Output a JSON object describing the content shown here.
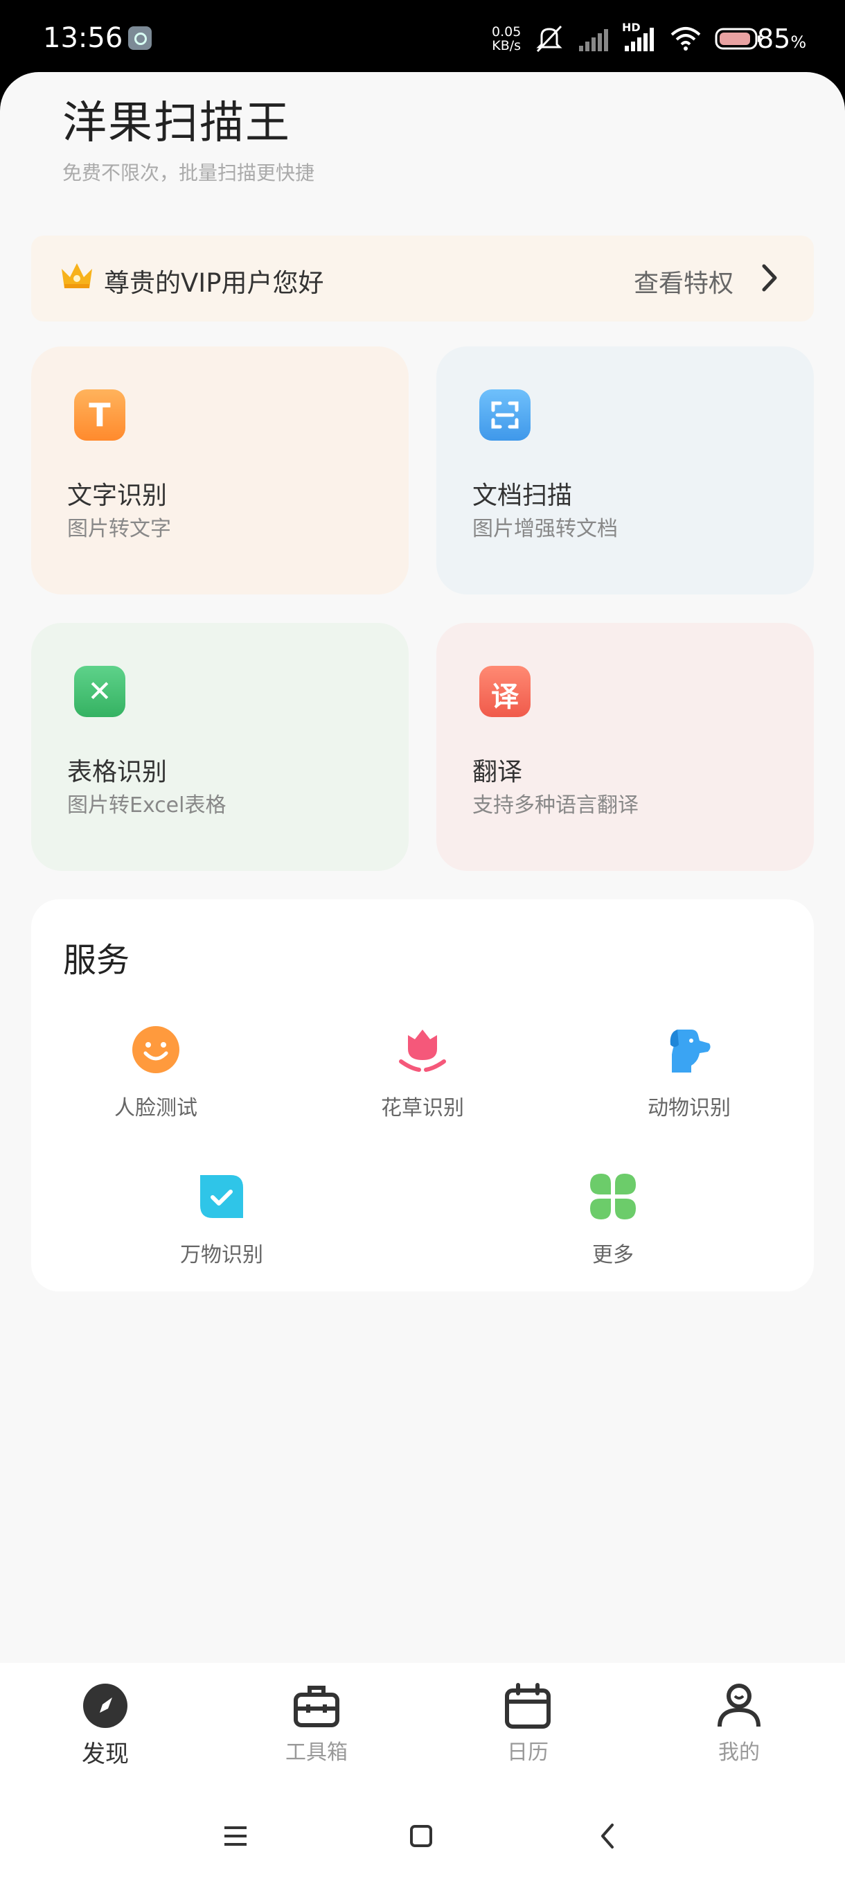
{
  "status_bar": {
    "time": "13:56",
    "net_speed_value": "0.05",
    "net_speed_unit": "KB/s",
    "hd_label": "HD",
    "battery_percent": "85",
    "battery_unit": "%"
  },
  "header": {
    "title": "洋果扫描王",
    "subtitle": "免费不限次，批量扫描更快捷"
  },
  "vip": {
    "greeting": "尊贵的VIP用户您好",
    "link_label": "查看特权"
  },
  "features": [
    {
      "title": "文字识别",
      "subtitle": "图片转文字",
      "icon": "text-recognition-icon",
      "icon_glyph": "T",
      "color": "#ff9a3d",
      "bg": "#fbf2ea"
    },
    {
      "title": "文档扫描",
      "subtitle": "图片增强转文档",
      "icon": "document-scan-icon",
      "color": "#4aa6f0",
      "bg": "#eef3f6"
    },
    {
      "title": "表格识别",
      "subtitle": "图片转Excel表格",
      "icon": "table-recognition-icon",
      "icon_glyph": "✕",
      "color": "#3dbb6a",
      "bg": "#eef5ee"
    },
    {
      "title": "翻译",
      "subtitle": "支持多种语言翻译",
      "icon": "translate-icon",
      "icon_glyph": "译",
      "color": "#f86a5a",
      "bg": "#f9eeed"
    }
  ],
  "services": {
    "title": "服务",
    "items": [
      {
        "label": "人脸测试",
        "icon": "smiley-face-icon",
        "color": "#ff9a3d"
      },
      {
        "label": "花草识别",
        "icon": "tulip-icon",
        "color": "#f5587a"
      },
      {
        "label": "动物识别",
        "icon": "dog-icon",
        "color": "#3aa4f3"
      },
      {
        "label": "万物识别",
        "icon": "check-bubble-icon",
        "color": "#2fc5e8"
      },
      {
        "label": "更多",
        "icon": "clover-icon",
        "color": "#6ccc6a"
      }
    ]
  },
  "tabs": [
    {
      "label": "发现",
      "icon": "compass-icon",
      "active": true
    },
    {
      "label": "工具箱",
      "icon": "toolbox-icon",
      "active": false
    },
    {
      "label": "日历",
      "icon": "calendar-icon",
      "active": false
    },
    {
      "label": "我的",
      "icon": "user-icon",
      "active": false
    }
  ],
  "system_nav": [
    "menu-icon",
    "home-square-icon",
    "back-chevron-icon"
  ]
}
